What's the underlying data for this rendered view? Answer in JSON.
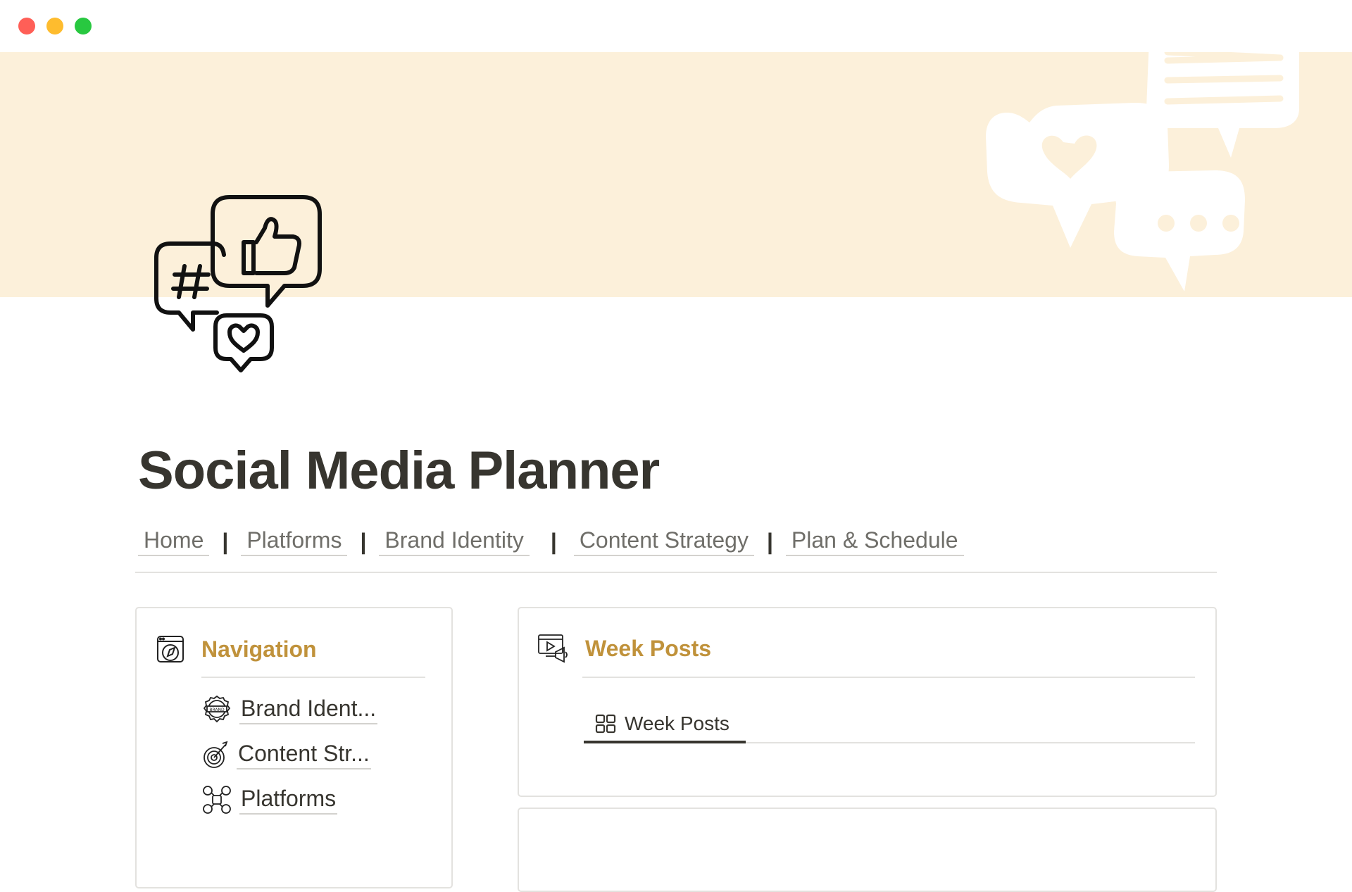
{
  "window": {
    "controls": [
      "close",
      "minimize",
      "maximize"
    ],
    "colors": {
      "close": "#ff5f57",
      "minimize": "#febc2e",
      "maximize": "#28c840"
    }
  },
  "cover": {
    "background": "#fcf0da",
    "art": "speech-bubbles-illustration"
  },
  "page": {
    "icon": "social-media-speech-bubbles-icon",
    "title": "Social Media Planner"
  },
  "top_nav": {
    "links": [
      "Home",
      "Platforms",
      "Brand Identity",
      "Content Strategy",
      "Plan & Schedule"
    ],
    "separator": "|"
  },
  "navigation_card": {
    "title": "Navigation",
    "title_color": "#c0923b",
    "icon": "compass-browser-icon",
    "items": [
      {
        "icon": "brand-badge-icon",
        "label": "Brand Ident..."
      },
      {
        "icon": "target-icon",
        "label": "Content Str..."
      },
      {
        "icon": "platforms-network-icon",
        "label": "Platforms"
      }
    ]
  },
  "week_card": {
    "title": "Week Posts",
    "title_color": "#c0923b",
    "icon": "video-megaphone-icon",
    "tab": {
      "icon": "gallery-grid-icon",
      "label": "Week Posts"
    }
  }
}
